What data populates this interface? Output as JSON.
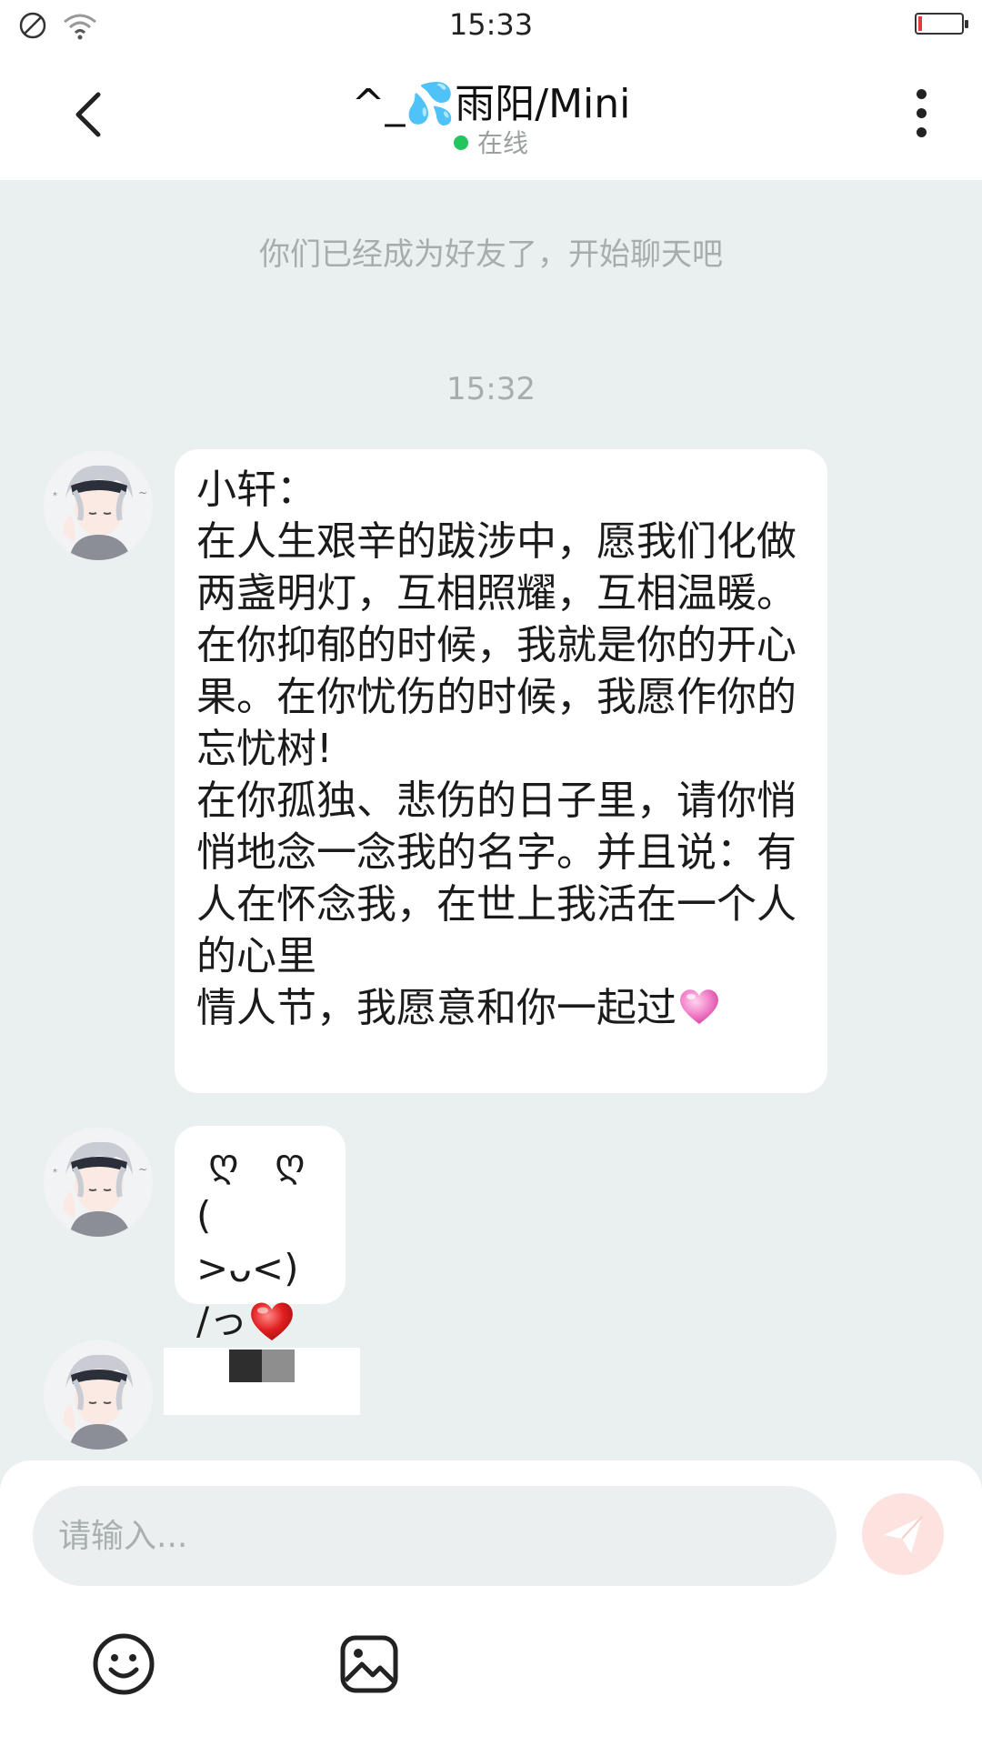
{
  "status_bar": {
    "time": "15:33"
  },
  "header": {
    "title": "^_💦雨阳/Mini",
    "status": "在线"
  },
  "chat": {
    "system_message": "你们已经成为好友了，开始聊天吧",
    "timestamp": "15:32",
    "messages": [
      {
        "text": "小轩：\n在人生艰辛的跋涉中，愿我们化做两盏明灯，互相照耀，互相温暖。\n在你抑郁的时候，我就是你的开心果。在你忧伤的时候，我愿作你的忘忧树!\n在你孤独、悲伤的日子里，请你悄悄地念一念我的名字。并且说：有人在怀念我，在世上我活在一个人的心里\n情人节，我愿意和你一起过"
      },
      {
        "text": " ღ   ღ\n( >ᴗ<)\n/っ"
      }
    ]
  },
  "input": {
    "placeholder": "请输入..."
  },
  "colors": {
    "online": "#22c55e",
    "send": "#fde3df",
    "background": "#eaf0ef"
  }
}
